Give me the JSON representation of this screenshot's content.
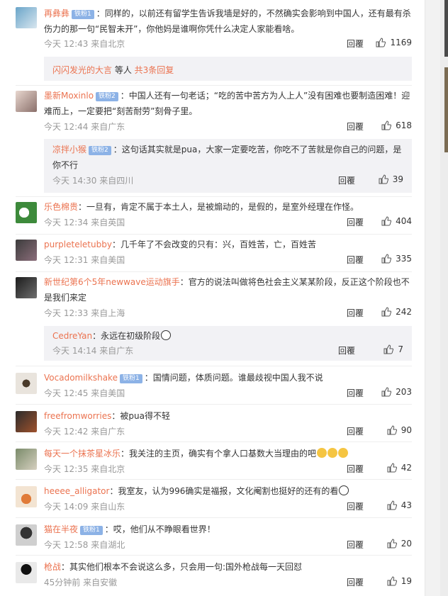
{
  "labels": {
    "reply": "回覆"
  },
  "comments": [
    {
      "user": "再彝彝",
      "badge": "铁粉1",
      "text": "：同样的，以前还有留学生告诉我墙是好的，不然确实会影响到中国人，还有最有杀伤力的那一句“民智未开”，你他妈是谁啊你凭什么决定人家能看啥。",
      "time": "今天 12:43 来自北京",
      "likes": "1169",
      "expand": {
        "user": "闪闪发光的大言",
        "text": " 等人 ",
        "count": "共3条回复"
      }
    },
    {
      "user": "墨新Moxinlo",
      "badge": "铁粉2",
      "text": "：中国人还有一句老话；“吃的苦中苦方为人上人”没有困难也要制造困难！迎难而上，一定要把“刻苦耐劳”刻骨子里。",
      "time": "今天 12:44 来自广东",
      "likes": "618",
      "sub": {
        "user": "凉拌小猴",
        "badge": "铁粉2",
        "text": "：这句话其实就是pua，大家一定要吃苦，你吃不了苦就是你自己的问题，是你不行",
        "time": "今天 14:30 来自四川",
        "likes": "39"
      }
    },
    {
      "user": "乐色棉贵",
      "text": "：一旦有，肯定不属于本土人，是被煽动的，是假的，是室外经理在作怪。",
      "time": "今天 12:34 来自英国",
      "likes": "404"
    },
    {
      "user": "purpleteletubby",
      "text": "：几千年了不会改变的只有：兴，百姓苦，亡，百姓苦",
      "time": "今天 12:31 来自美国",
      "likes": "335"
    },
    {
      "user": "新世纪第6个5年newwave运动旗手",
      "text": "：官方的说法叫做将色社会主义某某阶段，反正这个阶段也不是我们来定",
      "time": "今天 12:33 来自上海",
      "likes": "242",
      "sub": {
        "user": "CedreYan",
        "text": "：永远在初级阶段",
        "time": "今天 14:14 来自广东",
        "likes": "7"
      }
    },
    {
      "user": "Vocadomilkshake",
      "badge": "铁粉1",
      "text": "：国情问题，体质问题。谁最歧视中国人我不说",
      "time": "今天 12:45 来自美国",
      "likes": "203"
    },
    {
      "user": "freefromworries",
      "text": "：被pua得不轻",
      "time": "今天 12:42 来自广东",
      "likes": "90"
    },
    {
      "user": "每天一个抹茶星冰乐",
      "text": "：我关注的主页，确实有个拿人口基数大当理由的吧",
      "time": "今天 12:35 来自北京",
      "likes": "42"
    },
    {
      "user": "heeee_alligator",
      "text": "：我室友，认为996确实是福报，文化阉割也挺好的还有的看",
      "time": "今天 14:09 来自山东",
      "likes": "43"
    },
    {
      "user": "猫在半夜",
      "badge": "铁粉1",
      "text": "：哎，他们从不睁眼看世界！",
      "time": "今天 12:58 来自湖北",
      "likes": "20"
    },
    {
      "user": "枪战",
      "text": "：其实他们根本不会说这么多，只会用一句:国外枪战每一天回怼",
      "time": "45分钟前 来自安徽",
      "likes": "19"
    }
  ],
  "colors": {
    "username": "#eb7350",
    "badge": "#8cb2e6",
    "meta": "#999999"
  },
  "icons": [
    "thumb-up-icon",
    "avatar"
  ]
}
